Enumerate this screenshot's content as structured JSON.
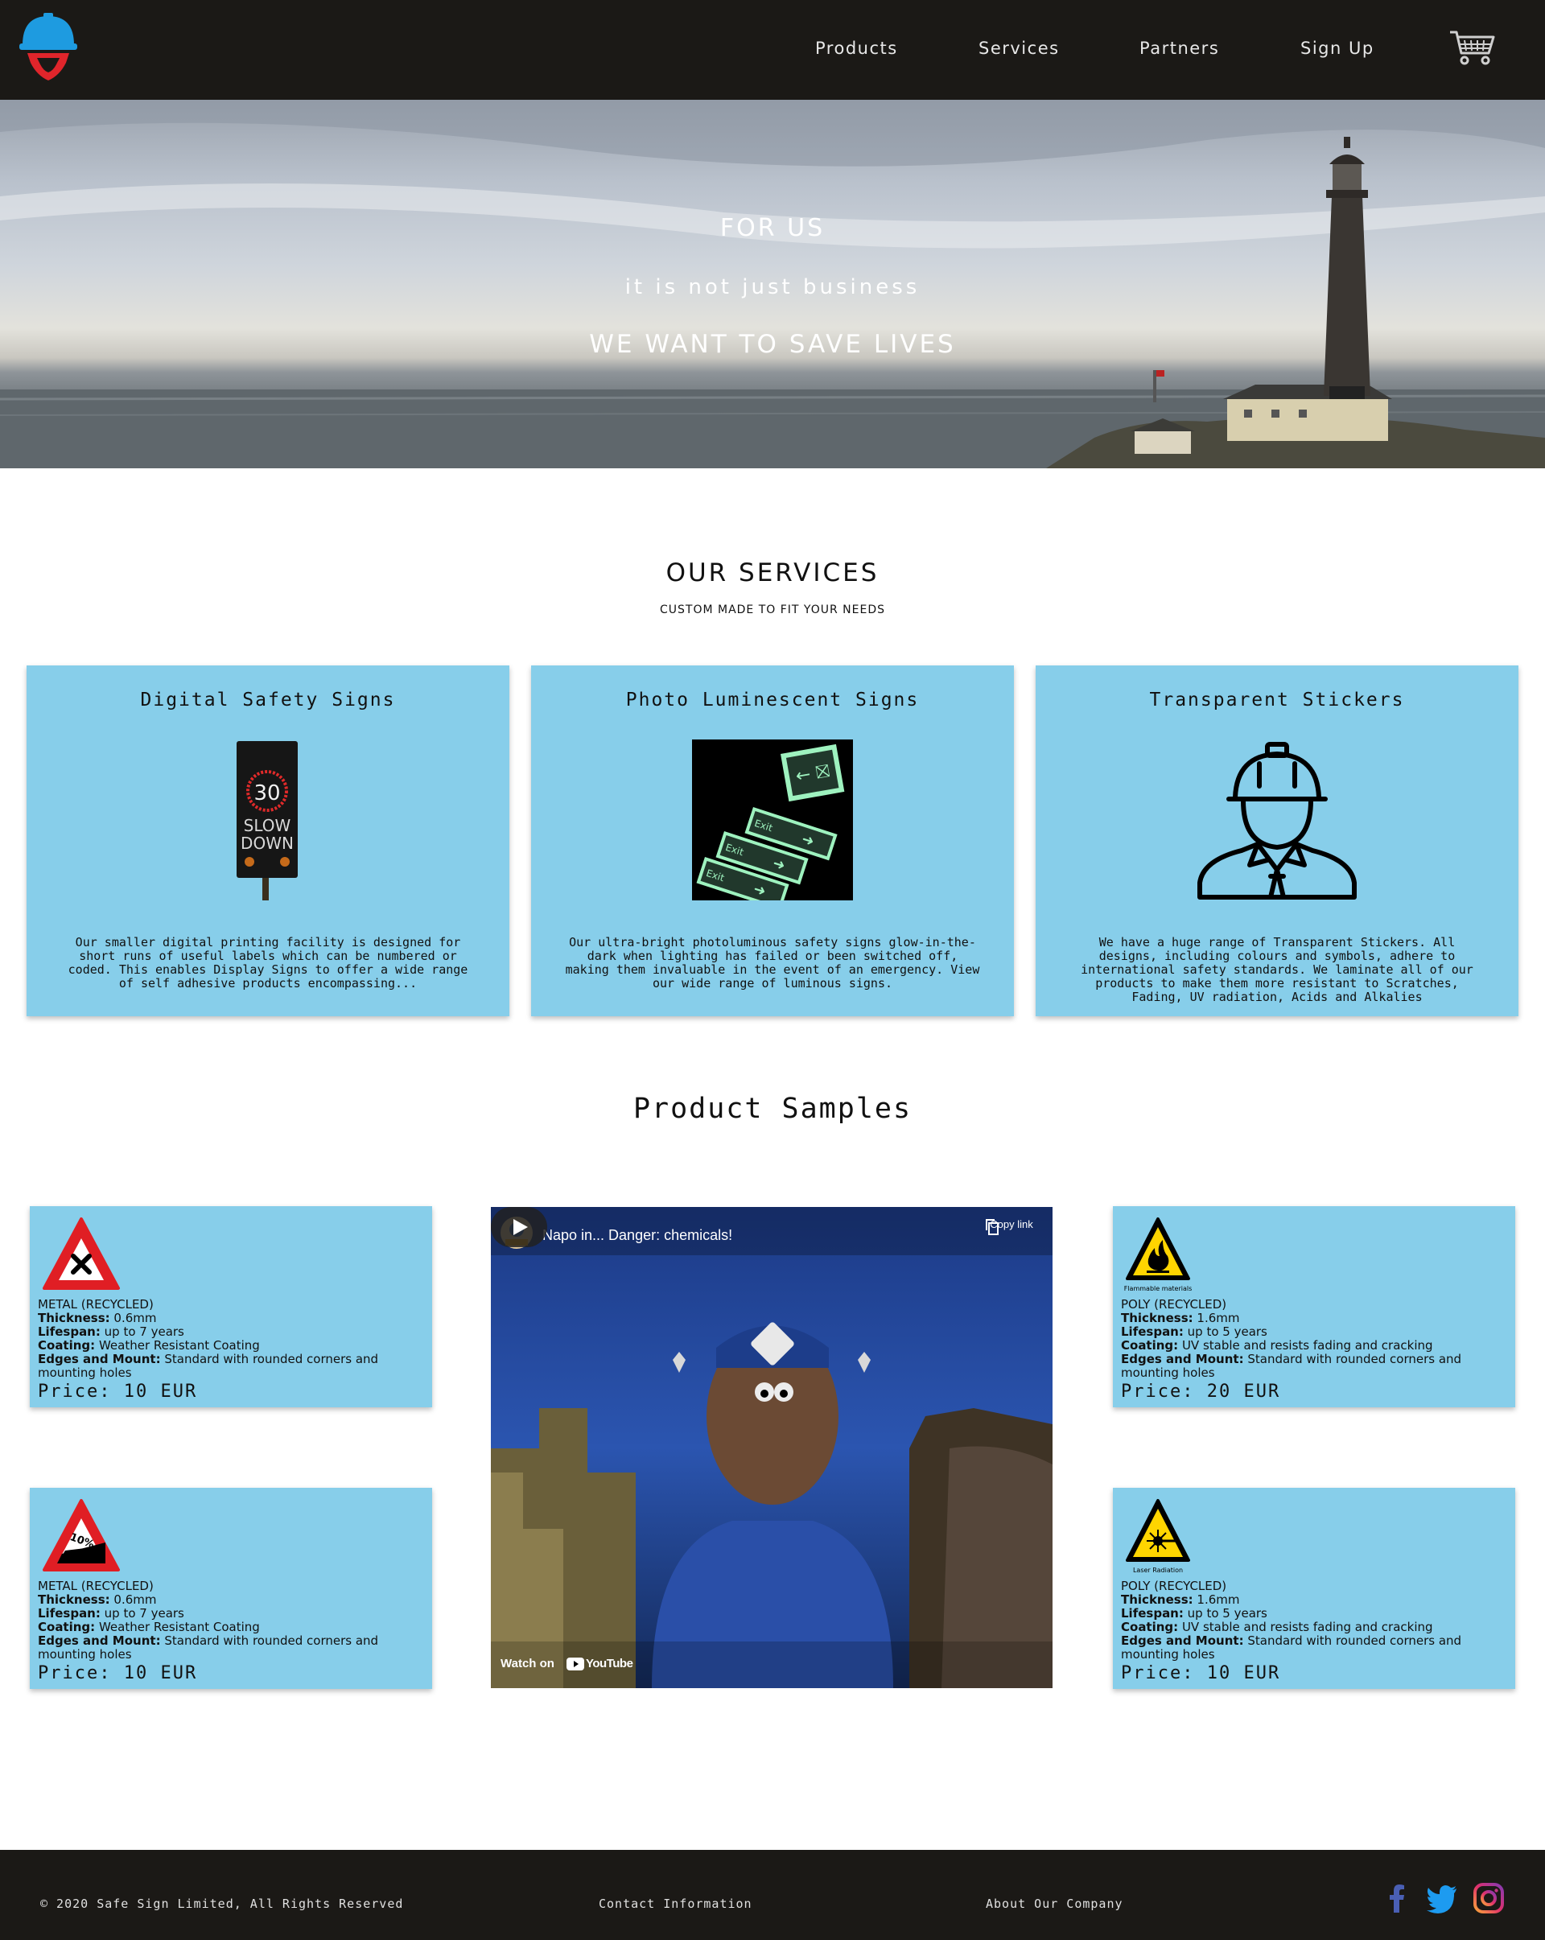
{
  "nav": {
    "links": [
      "Products",
      "Services",
      "Partners",
      "Sign Up"
    ]
  },
  "hero": {
    "line1": "FOR US",
    "line2": "it is not just business",
    "line3": "WE WANT TO SAVE LIVES"
  },
  "services": {
    "title": "OUR SERVICES",
    "subtitle": "CUSTOM MADE TO FIT YOUR NEEDS",
    "cards": [
      {
        "title": "Digital Safety Signs",
        "image": "digital-speed-sign-image",
        "image_text": [
          "30",
          "SLOW",
          "DOWN"
        ],
        "text": "Our smaller digital printing facility is designed for short runs of useful labels which can be numbered or coded. This enables Display Signs to offer a wide range of self adhesive products encompassing..."
      },
      {
        "title": "Photo Luminescent Signs",
        "image": "glow-exit-signs-image",
        "image_text": [
          "Exit",
          "Exit",
          "Exit"
        ],
        "text": "Our ultra-bright photoluminous safety signs glow-in-the-dark when lighting has failed or been switched off, making them invaluable in the event of an emergency. View our wide range of luminous signs."
      },
      {
        "title": "Transparent Stickers",
        "image": "worker-helmet-icon",
        "text": "We have a huge range of Transparent Stickers. All designs, including colours and symbols, adhere to international safety standards. We laminate all of our products to make them more resistant to Scratches, Fading, UV radiation, Acids and Alkalies"
      }
    ]
  },
  "samples": {
    "title": "Product Samples",
    "labels": {
      "thickness": "Thickness:",
      "lifespan": "Lifespan:",
      "coating": "Coating:",
      "edges": "Edges and Mount:",
      "price": "Price:"
    },
    "products": [
      {
        "icon": "crossroads-warning-icon",
        "material": "METAL (RECYCLED)",
        "thickness": "0.6mm",
        "lifespan": "up to 7 years",
        "coating": "Weather Resistant Coating",
        "edges": "Standard with rounded corners and mounting holes",
        "price": "10 EUR"
      },
      {
        "icon": "steep-hill-warning-icon",
        "icon_text": "10%",
        "material": "METAL (RECYCLED)",
        "thickness": "0.6mm",
        "lifespan": "up to 7 years",
        "coating": "Weather Resistant Coating",
        "edges": "Standard with rounded corners and mounting holes",
        "price": "10 EUR"
      },
      {
        "icon": "flammable-warning-icon",
        "icon_caption": "Flammable materials",
        "material": "POLY (RECYCLED)",
        "thickness": "1.6mm",
        "lifespan": "up to 5 years",
        "coating": "UV stable and resists fading and cracking",
        "edges": "Standard with rounded corners and mounting holes",
        "price": "20 EUR"
      },
      {
        "icon": "laser-warning-icon",
        "icon_caption": "Laser Radiation",
        "material": "POLY (RECYCLED)",
        "thickness": "1.6mm",
        "lifespan": "up to 5 years",
        "coating": "UV stable and resists fading and cracking",
        "edges": "Standard with rounded corners and mounting holes",
        "price": "10 EUR"
      }
    ],
    "video": {
      "title": "Napo in... Danger: chemicals!",
      "copy_label": "Copy link",
      "watch_on": "Watch on",
      "youtube": "YouTube"
    }
  },
  "footer": {
    "copyright": "© 2020 Safe Sign Limited, All Rights Reserved",
    "contact": "Contact Information",
    "about": "About Our Company",
    "social": [
      "facebook-icon",
      "twitter-icon",
      "instagram-icon"
    ]
  },
  "colors": {
    "nav_bg": "#1b1916",
    "card_bg": "#87ceea",
    "logo_helmet": "#1e9be0",
    "logo_shield": "#e0252b",
    "facebook": "#4a5fb4",
    "twitter": "#1d9bf0",
    "instagram": "#c13584"
  }
}
